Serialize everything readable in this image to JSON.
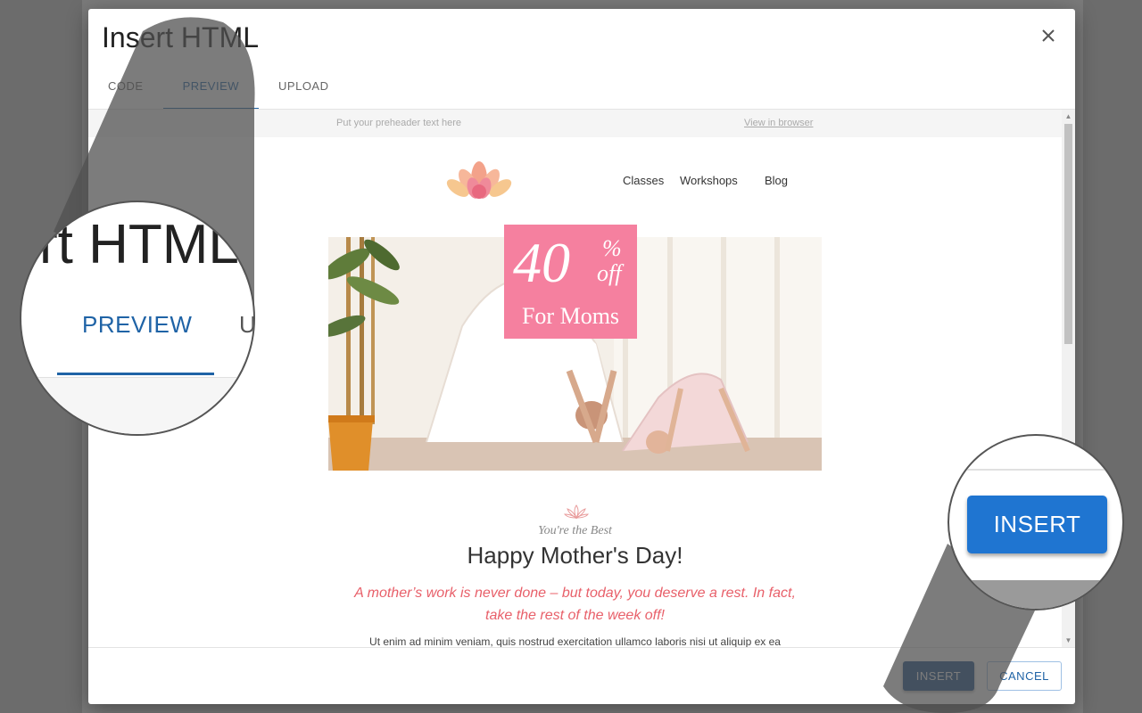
{
  "dialog": {
    "title": "Insert HTML",
    "close_icon": "close-icon"
  },
  "tabs": [
    {
      "label": "CODE",
      "active": false
    },
    {
      "label": "PREVIEW",
      "active": true
    },
    {
      "label": "UPLOAD",
      "active": false
    }
  ],
  "preview": {
    "preheader": "Put your preheader text here",
    "view_in_browser": "View in browser",
    "nav": [
      "Classes",
      "Workshops",
      "Blog"
    ],
    "logo_icon": "lotus-logo-icon",
    "promo": {
      "amount": "40",
      "percent": "%",
      "off": "off",
      "label": "For Moms"
    },
    "subtitle": "You're the Best",
    "headline": "Happy Mother's Day!",
    "intro": "A mother’s work is never done – but today, you deserve a rest. In fact, take the rest of the week off!",
    "body": "Ut enim ad minim veniam, quis nostrud exercitation ullamco laboris nisi ut aliquip ex ea"
  },
  "footer": {
    "insert_label": "INSERT",
    "cancel_label": "CANCEL"
  },
  "magnifiers": {
    "title_fragment": "rt HTML",
    "tab_preview": "PREVIEW",
    "tab_next_fragment": "U",
    "insert_label": "INSERT"
  },
  "colors": {
    "accent": "#1f63a6",
    "insert_button": "#1f4f8a",
    "promo_pink": "#f5809f",
    "intro_text": "#e8606a"
  }
}
